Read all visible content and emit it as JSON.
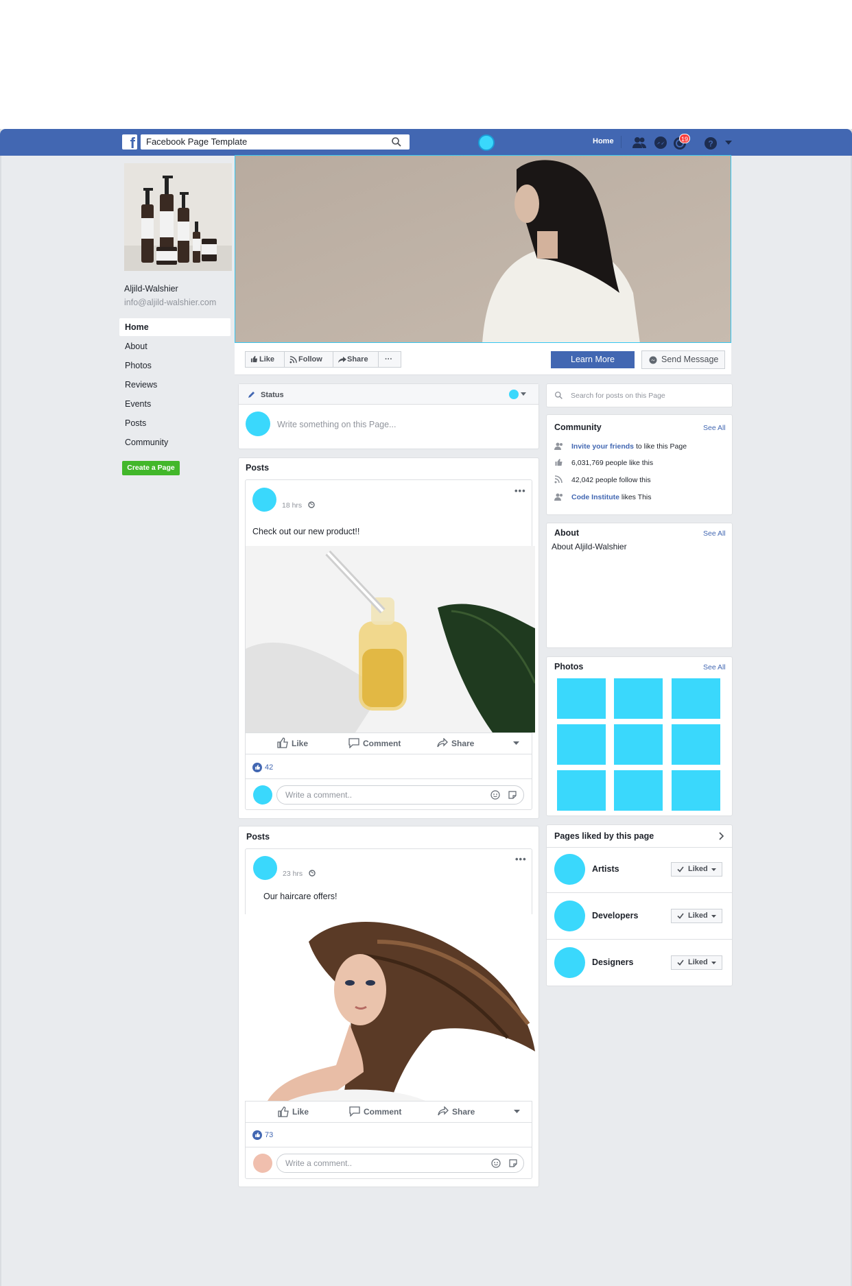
{
  "topbar": {
    "search_value": "Facebook Page Template",
    "home_label": "Home",
    "notification_count": "19"
  },
  "profile": {
    "name": "Aljild-Walshier",
    "email": "info@aljild-walshier.com"
  },
  "left_nav": [
    {
      "label": "Home"
    },
    {
      "label": "About"
    },
    {
      "label": "Photos"
    },
    {
      "label": "Reviews"
    },
    {
      "label": "Events"
    },
    {
      "label": "Posts"
    },
    {
      "label": "Community"
    }
  ],
  "create_page_label": "Create a Page",
  "action_bar": {
    "like": "Like",
    "follow": "Follow",
    "share": "Share",
    "more": "···",
    "learn_more": "Learn More",
    "send_message": "Send Message"
  },
  "status": {
    "label": "Status",
    "placeholder": "Write something on this Page..."
  },
  "posts": [
    {
      "section_title": "Posts",
      "time": "18 hrs",
      "text": "Check out our new product!!",
      "like_label": "Like",
      "comment_label": "Comment",
      "share_label": "Share",
      "reactions": "42",
      "comment_placeholder": "Write a comment.."
    },
    {
      "section_title": "Posts",
      "time": "23 hrs",
      "text": "Our haircare offers!",
      "like_label": "Like",
      "comment_label": "Comment",
      "share_label": "Share",
      "reactions": "73",
      "comment_placeholder": "Write a comment.."
    }
  ],
  "right": {
    "search_placeholder": "Search for posts on this Page",
    "community": {
      "title": "Community",
      "see_all": "See All",
      "invite_link": "Invite your friends",
      "invite_rest": " to like this Page",
      "likes": "6,031,769 people like this",
      "follows": "42,042 people follow this",
      "friend_link": "Code Institute",
      "friend_rest": " likes This"
    },
    "about": {
      "title": "About",
      "see_all": "See All",
      "text": "About Aljild-Walshier"
    },
    "photos": {
      "title": "Photos",
      "see_all": "See All"
    },
    "pages_liked": {
      "title": "Pages liked by this page",
      "liked_label": "Liked",
      "items": [
        {
          "name": "Artists"
        },
        {
          "name": "Developers"
        },
        {
          "name": "Designers"
        }
      ]
    }
  },
  "colors": {
    "brand": "#4267b2",
    "accent_cyan": "#3ad8fc",
    "create_green": "#42b72a",
    "badge_red": "#fa3e3e"
  }
}
